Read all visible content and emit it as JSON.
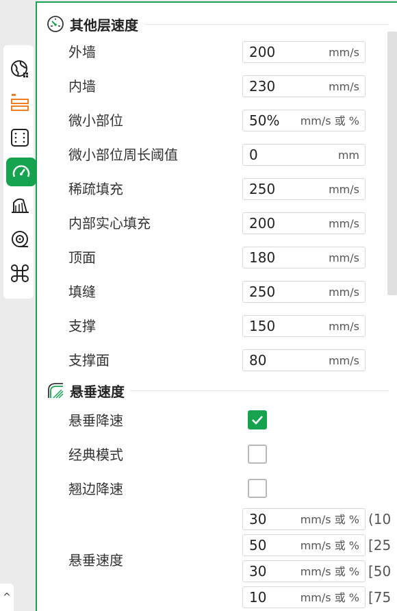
{
  "colors": {
    "accent": "#15a350",
    "tab_orange": "#f07d1f"
  },
  "tabs": [
    {
      "name": "quality-tab",
      "icon": "globe-grid-icon"
    },
    {
      "name": "strength-tab",
      "icon": "layers-orange-icon"
    },
    {
      "name": "support-tab",
      "icon": "dotted-square-icon"
    },
    {
      "name": "speed-tab",
      "icon": "speedometer-icon",
      "active": true
    },
    {
      "name": "multimaterial-tab",
      "icon": "tower-icon"
    },
    {
      "name": "filament-tab",
      "icon": "spool-icon"
    },
    {
      "name": "others-tab",
      "icon": "command-icon"
    }
  ],
  "other_layers": {
    "title": "其他层速度",
    "rows": [
      {
        "label": "外墙",
        "value": "200",
        "unit": "mm/s"
      },
      {
        "label": "内墙",
        "value": "230",
        "unit": "mm/s"
      },
      {
        "label": "微小部位",
        "value": "50%",
        "unit": "mm/s 或 %"
      },
      {
        "label": "微小部位周长阈值",
        "value": "0",
        "unit": "mm"
      },
      {
        "label": "稀疏填充",
        "value": "250",
        "unit": "mm/s"
      },
      {
        "label": "内部实心填充",
        "value": "200",
        "unit": "mm/s"
      },
      {
        "label": "顶面",
        "value": "180",
        "unit": "mm/s"
      },
      {
        "label": "填缝",
        "value": "250",
        "unit": "mm/s"
      },
      {
        "label": "支撑",
        "value": "150",
        "unit": "mm/s"
      },
      {
        "label": "支撑面",
        "value": "80",
        "unit": "mm/s"
      }
    ]
  },
  "overhang": {
    "title": "悬垂速度",
    "checks": [
      {
        "label": "悬垂降速",
        "checked": true
      },
      {
        "label": "经典模式",
        "checked": false
      },
      {
        "label": "翘边降速",
        "checked": false
      }
    ],
    "speed_label": "悬垂速度",
    "speeds": [
      {
        "value": "30",
        "unit": "mm/s 或 %",
        "range": "(10"
      },
      {
        "value": "50",
        "unit": "mm/s 或 %",
        "range": "[25"
      },
      {
        "value": "30",
        "unit": "mm/s 或 %",
        "range": "[50"
      },
      {
        "value": "10",
        "unit": "mm/s 或 %",
        "range": "[75"
      }
    ]
  },
  "collapse_glyph": "^"
}
